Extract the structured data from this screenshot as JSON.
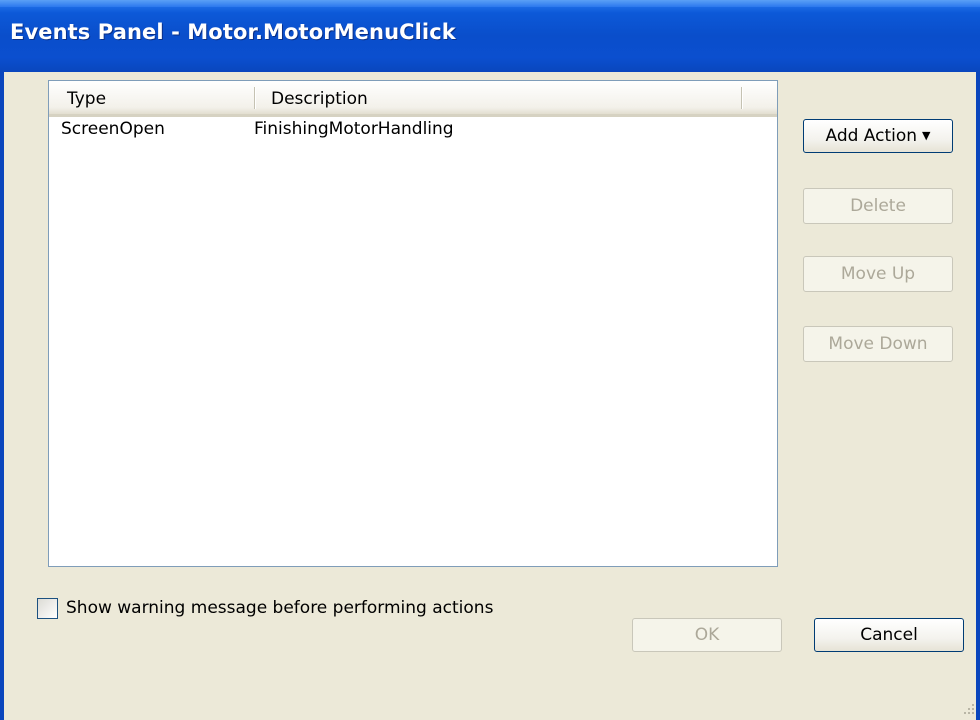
{
  "window": {
    "title": "Events Panel - Motor.MotorMenuClick"
  },
  "actions_list": {
    "columns": [
      "Type",
      "Description"
    ],
    "rows": [
      {
        "type": "ScreenOpen",
        "description": "FinishingMotorHandling"
      }
    ]
  },
  "side_buttons": {
    "add_action": "Add Action",
    "delete": "Delete",
    "move_up": "Move Up",
    "move_down": "Move Down"
  },
  "warning_option": {
    "label": "Show warning message before performing actions",
    "checked": false
  },
  "footer_buttons": {
    "ok": "OK",
    "cancel": "Cancel"
  },
  "colors": {
    "titlebar": "#0a4ecb",
    "dialog_bg": "#ece9d8",
    "disabled_text": "#aca899"
  }
}
